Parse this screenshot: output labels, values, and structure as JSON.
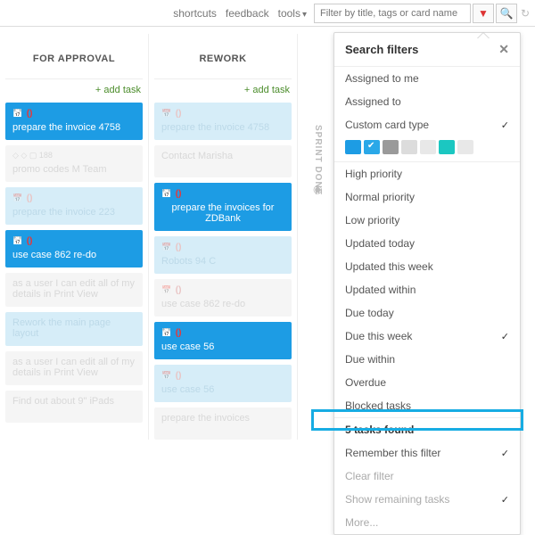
{
  "topbar": {
    "links": [
      "shortcuts",
      "feedback",
      "tools"
    ],
    "filter_placeholder": "Filter by title, tags or card name"
  },
  "columns": [
    {
      "title": "FOR APPROVAL",
      "add_label": "add task",
      "cards": [
        {
          "text": "prepare the invoice 4758",
          "style": "blue",
          "has_badge": true
        },
        {
          "text": "promo codes M Team",
          "style": "ghost-white",
          "meta": "188"
        },
        {
          "text": "prepare the invoice 223",
          "style": "ghost-blue",
          "has_badge": true
        },
        {
          "text": "use case 862 re-do",
          "style": "blue",
          "has_badge": true
        },
        {
          "text": "as a user I can edit all of my details in Print View",
          "style": "ghost-white"
        },
        {
          "text": "Rework the main page layout",
          "style": "ghost-blue"
        },
        {
          "text": "as a user I can edit all of my details in Print View",
          "style": "ghost-white"
        },
        {
          "text": "Find out about 9\" iPads",
          "style": "ghost-white"
        }
      ]
    },
    {
      "title": "REWORK",
      "add_label": "add task",
      "cards": [
        {
          "text": "prepare the invoice 4758",
          "style": "ghost-blue",
          "has_badge": true
        },
        {
          "text": "Contact Marisha",
          "style": "ghost-white"
        },
        {
          "text": "prepare the invoices for ZDBank",
          "style": "blue",
          "has_badge": true,
          "tall": true
        },
        {
          "text": "Robots 94 C",
          "style": "ghost-blue",
          "has_badge": true
        },
        {
          "text": "use case 862 re-do",
          "style": "ghost-white",
          "has_badge": true
        },
        {
          "text": "use case 56",
          "style": "blue",
          "has_badge": true
        },
        {
          "text": "use case 56",
          "style": "ghost-blue",
          "has_badge": true
        },
        {
          "text": "prepare the invoices",
          "style": "ghost-white"
        }
      ]
    }
  ],
  "sidelane_label": "SPRINT DONE",
  "panel": {
    "title": "Search filters",
    "group_a": [
      "Assigned to me",
      "Assigned to"
    ],
    "custom_type_label": "Custom card type",
    "swatch_colors": [
      "#1d9ce4",
      "#2aa8e8",
      "#9a9a9a",
      "#dcdcdc",
      "#e8e8e8",
      "#1bc7c1",
      "#e8e8e8"
    ],
    "swatch_selected_index": 1,
    "group_b": [
      {
        "label": "High priority",
        "checked": false
      },
      {
        "label": "Normal priority",
        "checked": false
      },
      {
        "label": "Low priority",
        "checked": false
      },
      {
        "label": "Updated today",
        "checked": false
      },
      {
        "label": "Updated this week",
        "checked": false
      },
      {
        "label": "Updated within",
        "checked": false
      },
      {
        "label": "Due today",
        "checked": false
      },
      {
        "label": "Due this week",
        "checked": true
      },
      {
        "label": "Due within",
        "checked": false
      },
      {
        "label": "Overdue",
        "checked": false
      },
      {
        "label": "Blocked tasks",
        "checked": false
      }
    ],
    "status_text": "5 tasks found",
    "footer": [
      {
        "label": "Remember this filter",
        "checked": true,
        "muted": false
      },
      {
        "label": "Clear filter",
        "checked": false,
        "muted": true
      },
      {
        "label": "Show remaining tasks",
        "checked": true,
        "muted": true
      },
      {
        "label": "More...",
        "checked": false,
        "muted": true
      }
    ]
  }
}
